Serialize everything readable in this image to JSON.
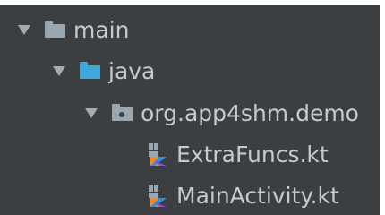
{
  "project_tree": {
    "items": [
      {
        "label": "main",
        "icon": "folder-icon",
        "expanded": true
      },
      {
        "label": "java",
        "icon": "source-folder-icon",
        "expanded": true
      },
      {
        "label": "org.app4shm.demo",
        "icon": "package-icon",
        "expanded": true
      },
      {
        "label": "ExtraFuncs.kt",
        "icon": "kotlin-file-icon"
      },
      {
        "label": "MainActivity.kt",
        "icon": "kotlin-file-icon"
      }
    ]
  },
  "colors": {
    "panel_background": "#3c3f41",
    "text": "#c9c9c9",
    "folder": "#9aa7b0",
    "source_folder": "#40a8dd",
    "kotlin_orange": "#f88a21",
    "kotlin_blue": "#2f8fe0"
  }
}
